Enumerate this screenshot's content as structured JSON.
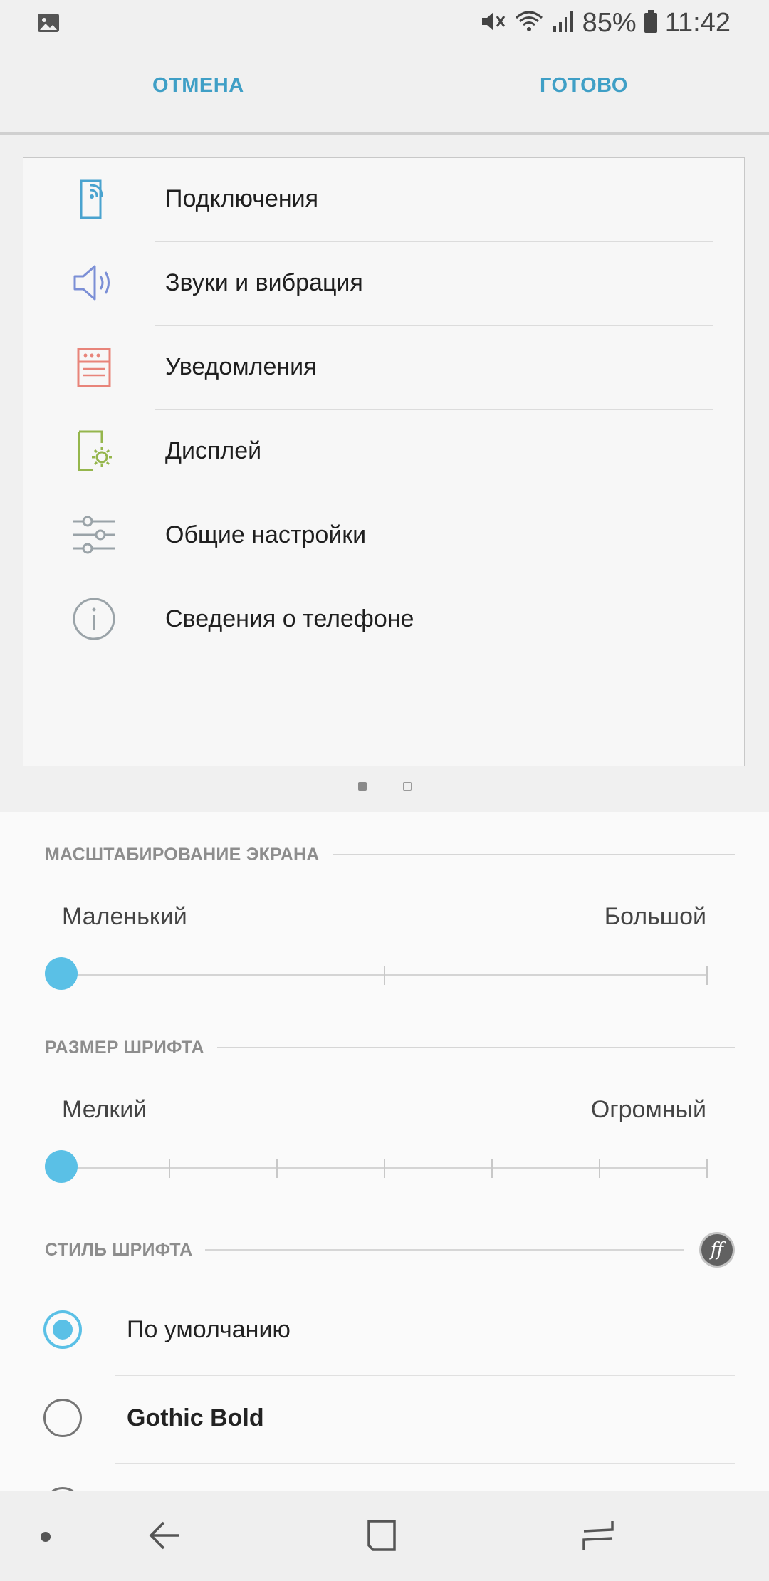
{
  "status_bar": {
    "battery": "85%",
    "time": "11:42",
    "icons": [
      "gallery-icon",
      "mute-icon",
      "wifi-icon",
      "signal-icon",
      "battery-icon"
    ]
  },
  "action_bar": {
    "cancel_label": "ОТМЕНА",
    "done_label": "ГОТОВО"
  },
  "preview": {
    "items": [
      {
        "label": "Подключения",
        "icon": "connections-icon",
        "color": "#4aa3cf"
      },
      {
        "label": "Звуки и вибрация",
        "icon": "sound-icon",
        "color": "#7b8fd6"
      },
      {
        "label": "Уведомления",
        "icon": "notifications-icon",
        "color": "#e8847a"
      },
      {
        "label": "Дисплей",
        "icon": "display-icon",
        "color": "#95b64c"
      },
      {
        "label": "Общие настройки",
        "icon": "general-settings-icon",
        "color": "#9aa3a8"
      },
      {
        "label": "Сведения о телефоне",
        "icon": "info-icon",
        "color": "#9aa3a8"
      }
    ],
    "pages": 2,
    "current_page": 1
  },
  "screen_zoom": {
    "title": "МАСШТАБИРОВАНИЕ ЭКРАНА",
    "min_label": "Маленький",
    "max_label": "Большой",
    "steps": 3,
    "value": 0
  },
  "font_size": {
    "title": "РАЗМЕР ШРИФТА",
    "min_label": "Мелкий",
    "max_label": "Огромный",
    "steps": 7,
    "value": 0
  },
  "font_style": {
    "title": "СТИЛЬ ШРИФТА",
    "options": [
      {
        "label": "По умолчанию",
        "checked": true
      },
      {
        "label": "Gothic Bold",
        "checked": false
      },
      {
        "label": "",
        "checked": false
      }
    ]
  },
  "colors": {
    "accent": "#5ac0e6",
    "action_text": "#3f9fc6"
  }
}
